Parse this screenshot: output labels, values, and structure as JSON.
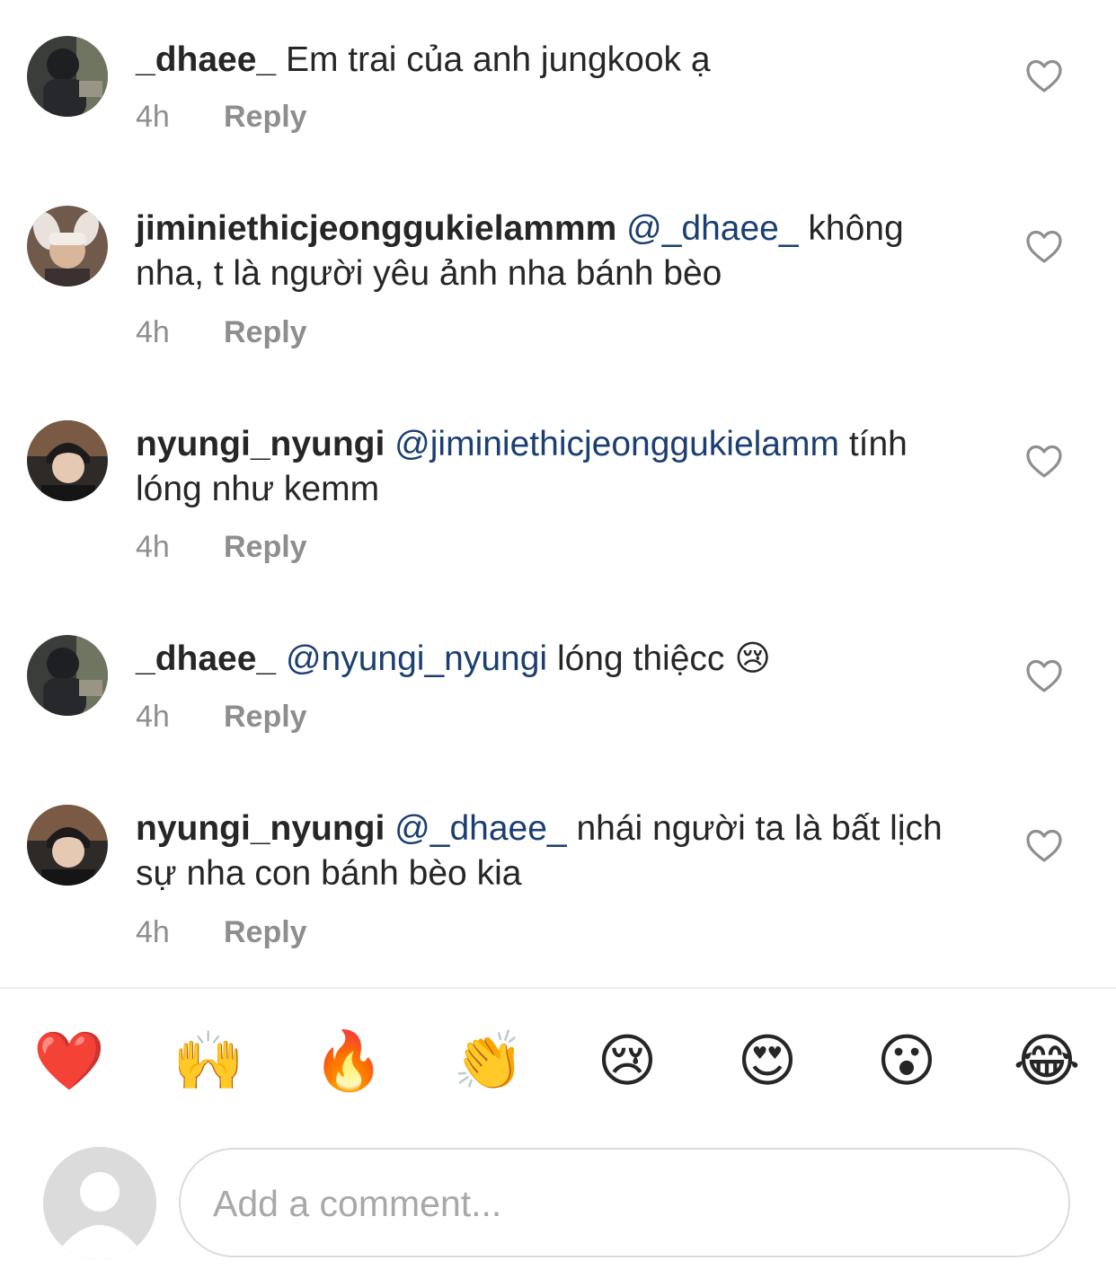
{
  "comments": [
    {
      "username": "_dhaee_",
      "mention": "",
      "text": "Em trai của anh jungkook ạ",
      "time": "4h",
      "reply_label": "Reply",
      "avatar_icon": "user-photo-avatar"
    },
    {
      "username": "jiminiethicjeonggukielammm",
      "mention": "@_dhaee_",
      "text": "không nha, t là người yêu ảnh nha bánh bèo",
      "time": "4h",
      "reply_label": "Reply",
      "avatar_icon": "user-photo-avatar"
    },
    {
      "username": "nyungi_nyungi",
      "mention": "@jiminiethicjeonggukielamm",
      "text": "tính lóng như kemm",
      "time": "4h",
      "reply_label": "Reply",
      "avatar_icon": "user-photo-avatar"
    },
    {
      "username": "_dhaee_",
      "mention": "@nyungi_nyungi",
      "text": "lóng thiệcc 😢",
      "time": "4h",
      "reply_label": "Reply",
      "avatar_icon": "user-photo-avatar"
    },
    {
      "username": "nyungi_nyungi",
      "mention": "@_dhaee_",
      "text": "nhái người ta là bất lịch sự nha con bánh bèo kia",
      "time": "4h",
      "reply_label": "Reply",
      "avatar_icon": "user-photo-avatar"
    }
  ],
  "emoji_bar": [
    "❤️",
    "🙌",
    "🔥",
    "👏",
    "😢",
    "😍",
    "😮",
    "😂"
  ],
  "composer": {
    "placeholder": "Add a comment...",
    "avatar_icon": "default-user-avatar"
  },
  "colors": {
    "text": "#262626",
    "meta": "#8e8e8e",
    "mention": "#1b3f72",
    "divider": "#ececec",
    "input_border": "#dbdbdb"
  }
}
